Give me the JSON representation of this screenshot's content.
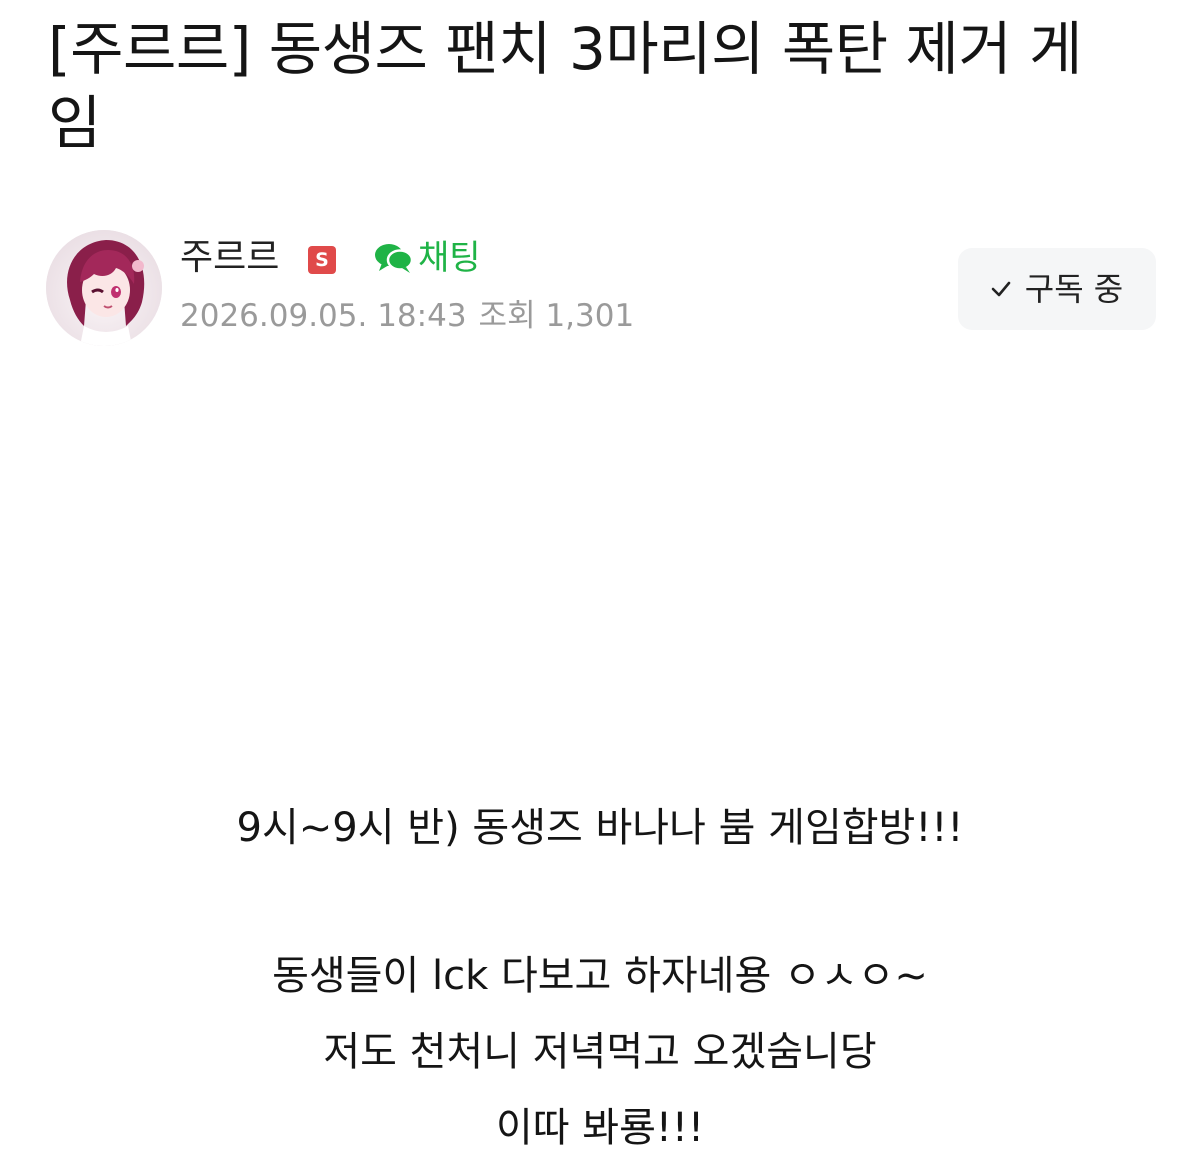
{
  "post": {
    "title": "[주르르] 동생즈 팬치 3마리의 폭탄 제거 게임"
  },
  "author": {
    "nickname": "주르르",
    "badge": "S",
    "badge_color": "#e04a4a",
    "chat_label": "채팅",
    "chat_color": "#1fb346",
    "chat_icon": "speech-bubble-icon",
    "date": "2026.09.05. 18:43",
    "views_label": "조회",
    "views": "1,301"
  },
  "subscribe": {
    "icon": "check-icon",
    "label": "구독 중"
  },
  "content": {
    "line1": "9시~9시 반) 동생즈 바나나 붐 게임합방!!!",
    "line2": "동생들이 lck 다보고 하자네용 ㅇㅅㅇ~",
    "line3": "저도 천처니 저녁먹고 오겠숨니당",
    "line4": "이따 봐룡!!!"
  }
}
